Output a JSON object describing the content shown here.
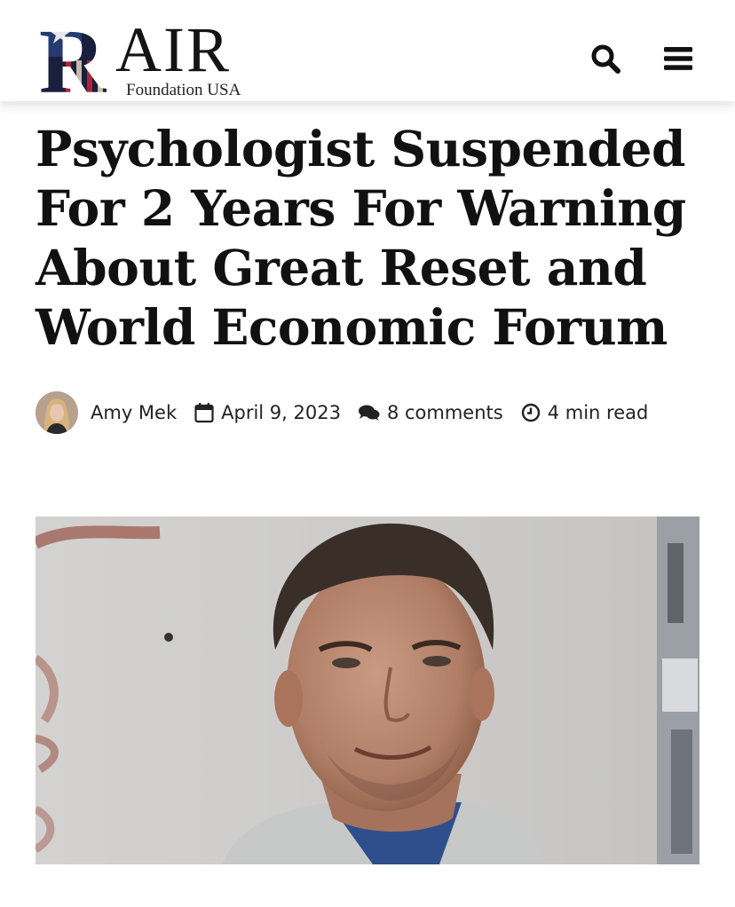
{
  "header": {
    "logo": {
      "letter_r": "R",
      "wordmark": "AIR",
      "subtitle": "Foundation USA"
    },
    "icons": {
      "search": "search-icon",
      "menu": "menu-icon"
    }
  },
  "article": {
    "title": "Psychologist Suspended For 2 Years For Warning About Great Reset and World Economic Forum",
    "author": "Amy Mek",
    "date": "April 9, 2023",
    "comments": "8 comments",
    "read_time": "4 min read",
    "icons": {
      "date": "calendar-icon",
      "comments": "comments-icon",
      "read_time": "clock-icon"
    }
  },
  "colors": {
    "text": "#111111",
    "flag_red": "#b22234",
    "flag_blue": "#2b3f7a"
  }
}
